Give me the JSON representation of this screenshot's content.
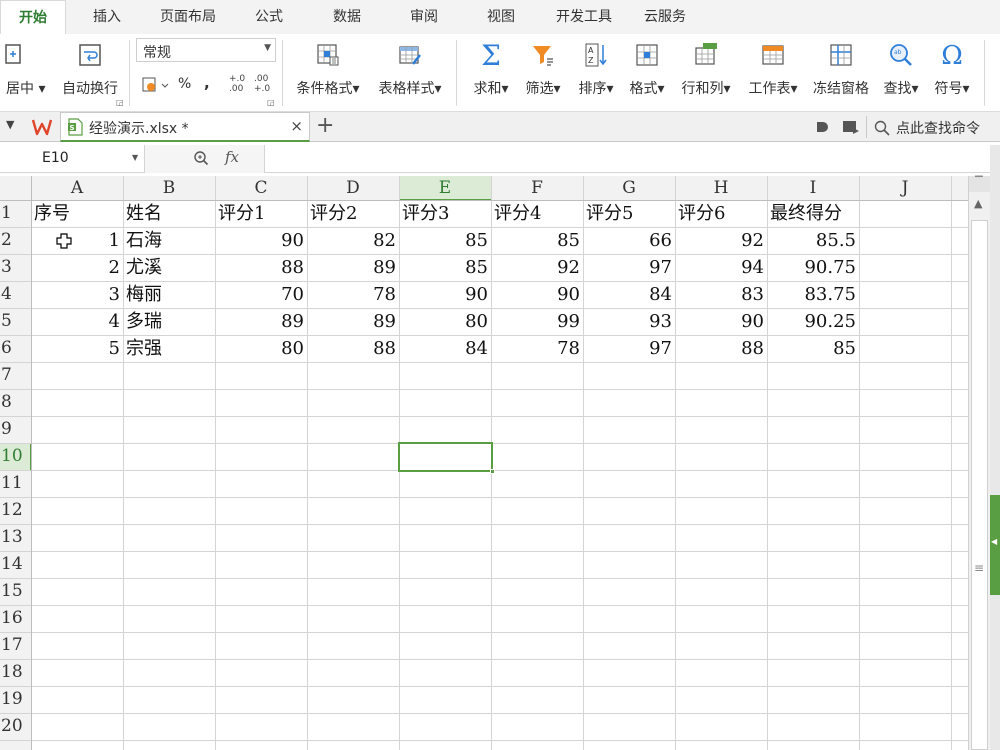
{
  "menu": {
    "tabs": [
      {
        "label": "开始",
        "active": true
      },
      {
        "label": "插入"
      },
      {
        "label": "页面布局"
      },
      {
        "label": "公式"
      },
      {
        "label": "数据"
      },
      {
        "label": "审阅"
      },
      {
        "label": "视图"
      },
      {
        "label": "开发工具"
      },
      {
        "label": "云服务"
      }
    ]
  },
  "ribbon": {
    "merge_center": "居中",
    "wrap_text": "自动换行",
    "number_format": "常规",
    "percent": "%",
    "comma": ",",
    "dec_increase": "+.0 .00",
    "dec_decrease": ".00 +.0",
    "cond_format": "条件格式",
    "table_style": "表格样式",
    "sum": "求和",
    "filter": "筛选",
    "sort": "排序",
    "format": "格式",
    "row_col": "行和列",
    "worksheet": "工作表",
    "freeze": "冻结窗格",
    "find": "查找",
    "symbol": "符号"
  },
  "tabstrip": {
    "doc_name": "经验演示.xlsx *",
    "close": "×",
    "new_tab": "+",
    "search_command": "点此查找命令"
  },
  "formula_bar": {
    "cell_ref": "E10",
    "fx": "fx",
    "formula": ""
  },
  "sheet": {
    "columns": [
      "A",
      "B",
      "C",
      "D",
      "E",
      "F",
      "G",
      "H",
      "I",
      "J"
    ],
    "rows": [
      "1",
      "2",
      "3",
      "4",
      "5",
      "6",
      "7",
      "8",
      "9",
      "10",
      "11",
      "12",
      "13",
      "14",
      "15",
      "16",
      "17",
      "18",
      "19",
      "20"
    ],
    "selected_col": "E",
    "selected_row": "10",
    "header": [
      "序号",
      "姓名",
      "评分1",
      "评分2",
      "评分3",
      "评分4",
      "评分5",
      "评分6",
      "最终得分"
    ],
    "data": [
      [
        "1",
        "石海",
        "90",
        "82",
        "85",
        "85",
        "66",
        "92",
        "85.5"
      ],
      [
        "2",
        "尤溪",
        "88",
        "89",
        "85",
        "92",
        "97",
        "94",
        "90.75"
      ],
      [
        "3",
        "梅丽",
        "70",
        "78",
        "90",
        "90",
        "84",
        "83",
        "83.75"
      ],
      [
        "4",
        "多瑞",
        "89",
        "89",
        "80",
        "99",
        "93",
        "90",
        "90.25"
      ],
      [
        "5",
        "宗强",
        "80",
        "88",
        "84",
        "78",
        "97",
        "88",
        "85"
      ]
    ]
  },
  "colors": {
    "accent_green": "#5a9e43",
    "active_tab_text": "#2e7d32",
    "grid": "#d4d4d4",
    "header_bg": "#f2f2f2",
    "selected_header_bg": "#dcebd6",
    "icon_blue": "#2f7fd8",
    "icon_orange": "#f08a24"
  }
}
